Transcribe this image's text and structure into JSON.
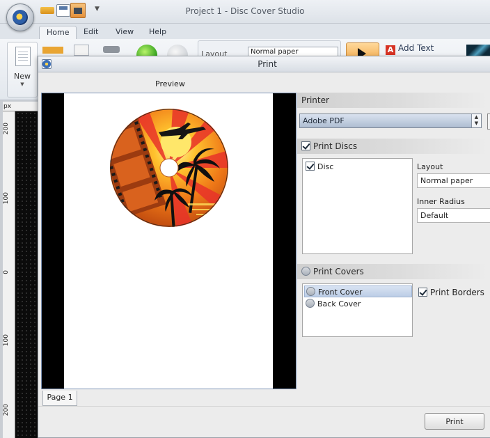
{
  "app": {
    "title": "Project 1 - Disc Cover Studio",
    "menu": [
      "Home",
      "Edit",
      "View",
      "Help"
    ],
    "active_menu": "Home"
  },
  "ribbon": {
    "new_label": "New",
    "layout_label": "Layout",
    "layout_value": "Normal paper",
    "add_text_label": "Add Text"
  },
  "ruler": {
    "unit": "px",
    "ticks": [
      "200",
      "100",
      "0",
      "100",
      "200"
    ]
  },
  "dialog": {
    "title": "Print",
    "preview_label": "Preview",
    "page_tab": "Page 1",
    "printer": {
      "header": "Printer",
      "selected": "Adobe PDF"
    },
    "discs": {
      "header": "Print Discs",
      "checked": true,
      "items": [
        {
          "label": "Disc",
          "checked": true
        }
      ],
      "layout_label": "Layout",
      "layout_value": "Normal paper",
      "inner_radius_label": "Inner Radius",
      "inner_radius_value": "Default"
    },
    "covers": {
      "header": "Print Covers",
      "checked": false,
      "items": [
        {
          "label": "Front Cover",
          "checked": false,
          "selected": true
        },
        {
          "label": "Back Cover",
          "checked": false,
          "selected": false
        }
      ],
      "print_borders_label": "Print Borders",
      "print_borders_checked": true
    },
    "print_button": "Print"
  },
  "colors": {
    "selection": "#bccde6",
    "section_header": "#d0d0d0",
    "accent_orange": "#e48f3a"
  }
}
